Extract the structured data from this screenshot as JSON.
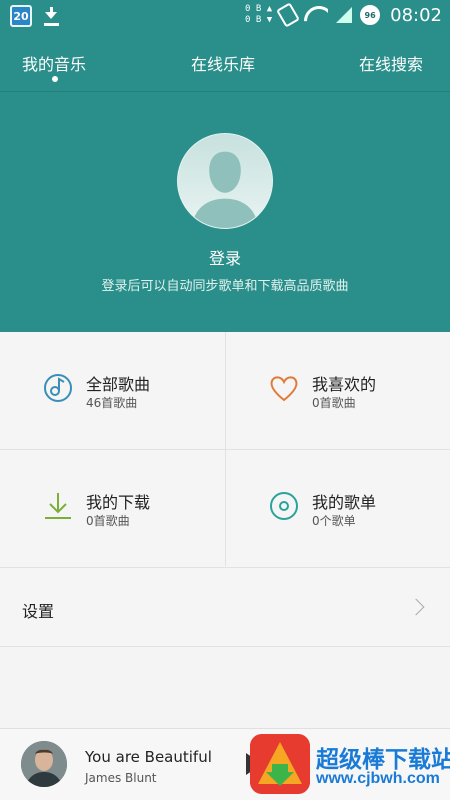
{
  "status_bar": {
    "calendar_day": "20",
    "net_up": "0 B ▲",
    "net_down": "0 B ▼",
    "battery": "96",
    "time": "08:02",
    "icons": [
      "calendar-icon",
      "download-icon",
      "rotate-icon",
      "wifi-icon",
      "signal-icon",
      "battery-icon"
    ]
  },
  "tabs": [
    {
      "label": "我的音乐",
      "active": true
    },
    {
      "label": "在线乐库",
      "active": false
    },
    {
      "label": "在线搜索",
      "active": false
    }
  ],
  "login": {
    "title": "登录",
    "subtitle": "登录后可以自动同步歌单和下载高品质歌曲"
  },
  "grid": [
    {
      "title": "全部歌曲",
      "sub": "46首歌曲",
      "icon": "music-note-icon",
      "color": "#3a8fb7"
    },
    {
      "title": "我喜欢的",
      "sub": "0首歌曲",
      "icon": "heart-icon",
      "color": "#e07a3a"
    },
    {
      "title": "我的下载",
      "sub": "0首歌曲",
      "icon": "download-icon",
      "color": "#7ab03a"
    },
    {
      "title": "我的歌单",
      "sub": "0个歌单",
      "icon": "disc-icon",
      "color": "#2aa39a"
    }
  ],
  "settings": {
    "label": "设置"
  },
  "player": {
    "song": "You are Beautiful",
    "artist": "James Blunt"
  },
  "watermark": {
    "name": "超级棒下载站",
    "url": "www.cjbwh.com"
  },
  "colors": {
    "primary": "#2a8f8a",
    "background": "#f5f5f5"
  }
}
